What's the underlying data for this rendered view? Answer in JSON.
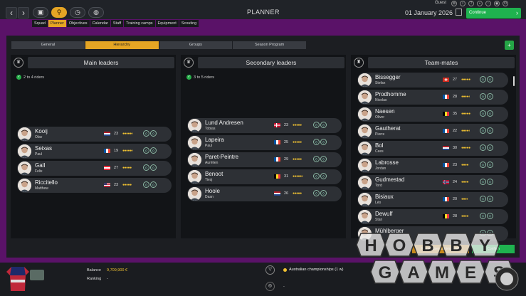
{
  "topbar": {
    "title": "PLANNER",
    "guest": "Guest",
    "date": "01 January 2026",
    "continue_label": "Continue",
    "back": "‹",
    "forward": "›",
    "icons": [
      "briefcase-icon",
      "cycling-icon",
      "clock-icon",
      "world-icon"
    ]
  },
  "submenu": [
    "Squad",
    "Planner",
    "Objectives",
    "Calendar",
    "Staff",
    "Training camps",
    "Equipment",
    "Scouting"
  ],
  "tabs": [
    "General",
    "Hierarchy",
    "Groups",
    "Season Program"
  ],
  "panels": [
    {
      "title": "Main leaders",
      "requirement": "2 to 4 riders",
      "riders": [
        {
          "last": "Kooij",
          "first": "Olav",
          "age": "23",
          "stars": "●●●●●◐",
          "flag": "nl"
        },
        {
          "last": "Seixas",
          "first": "Paul",
          "age": "19",
          "stars": "●●●●●◐",
          "flag": "fr"
        },
        {
          "last": "Gall",
          "first": "Felix",
          "age": "27",
          "stars": "●●●●●",
          "flag": "at"
        },
        {
          "last": "Riccitello",
          "first": "Matthew",
          "age": "23",
          "stars": "●●●●●",
          "flag": "us"
        }
      ]
    },
    {
      "title": "Secondary leaders",
      "requirement": "3 to 5 riders",
      "riders": [
        {
          "last": "Lund Andresen",
          "first": "Tobias",
          "age": "23",
          "stars": "●●●●●",
          "flag": "dk"
        },
        {
          "last": "Lapeira",
          "first": "Paul",
          "age": "25",
          "stars": "●●●●●",
          "flag": "fr"
        },
        {
          "last": "Paret-Peintre",
          "first": "Aurélien",
          "age": "29",
          "stars": "●●●●●",
          "flag": "fr"
        },
        {
          "last": "Benoot",
          "first": "Tiesj",
          "age": "31",
          "stars": "●●●●●◐",
          "flag": "be"
        },
        {
          "last": "Hoole",
          "first": "Daan",
          "age": "26",
          "stars": "●●●●●",
          "flag": "nl"
        }
      ]
    },
    {
      "title": "Team-mates",
      "requirement": "",
      "riders": [
        {
          "last": "Bissegger",
          "first": "Stefan",
          "age": "27",
          "stars": "●●●●●",
          "flag": "ch"
        },
        {
          "last": "Prodhomme",
          "first": "Nicolas",
          "age": "28",
          "stars": "●●●●◐",
          "flag": "fr"
        },
        {
          "last": "Naesen",
          "first": "Oliver",
          "age": "35",
          "stars": "●●●●●",
          "flag": "be"
        },
        {
          "last": "Gautherat",
          "first": "Pierre",
          "age": "22",
          "stars": "●●●●◐",
          "flag": "fr"
        },
        {
          "last": "Bol",
          "first": "Cees",
          "age": "30",
          "stars": "●●●●●",
          "flag": "nl"
        },
        {
          "last": "Labrosse",
          "first": "Jordan",
          "age": "23",
          "stars": "●●●●",
          "flag": "fr"
        },
        {
          "last": "Gudmestad",
          "first": "Tord",
          "age": "24",
          "stars": "●●●●",
          "flag": "no"
        },
        {
          "last": "Bisiaux",
          "first": "Léo",
          "age": "20",
          "stars": "●●●◐",
          "flag": "fr"
        },
        {
          "last": "Dewulf",
          "first": "Stan",
          "age": "28",
          "stars": "●●●●",
          "flag": "be"
        },
        {
          "last": "Mühlberger",
          "first": "",
          "age": "",
          "stars": "",
          "flag": ""
        }
      ]
    }
  ],
  "bottom_buttons": {
    "left": "Réinitialiser la hiérarchie",
    "right": "Confirm"
  },
  "bottombar": {
    "balance_label": "Balance",
    "balance_value": "9,709,900 €",
    "ranking_label": "Ranking",
    "ranking_value": "-",
    "championship": "Australian championships (1 w)",
    "second_line": "-"
  },
  "watermark": {
    "line1": "HOBBY",
    "line2": "GAMES"
  },
  "colors": {
    "accent": "#e5a524",
    "green": "#1fb24f",
    "bg": "#5a1268"
  }
}
